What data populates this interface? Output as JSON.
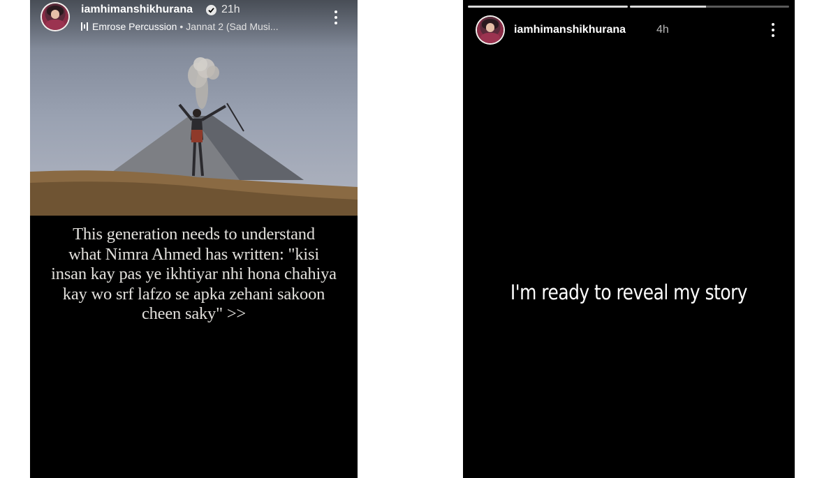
{
  "story_left": {
    "username": "iamhimanshikhurana",
    "time": "21h",
    "verified": true,
    "music": {
      "artist": "Emrose Percussion",
      "separator": "•",
      "song": "Jannat 2 (Sad Musi..."
    },
    "caption_lines": [
      "This generation needs to understand",
      "what Nimra Ahmed has written: \"kisi",
      "insan kay pas ye ikhtiyar nhi hona chahiya",
      "kay wo srf lafzo se apka zehani sakoon",
      "cheen saky\" >>"
    ],
    "icons": {
      "more": "more-vertical-icon",
      "verified": "verified-badge-icon",
      "music": "music-bars-icon"
    }
  },
  "story_right": {
    "username": "iamhimanshikhurana",
    "time": "4h",
    "progress": [
      1.0,
      0.48
    ],
    "text": "I'm ready to reveal my story",
    "icons": {
      "more": "more-vertical-icon"
    }
  },
  "colors": {
    "story_background": "#000000",
    "page_background": "#ffffff",
    "caption_text": "#e2e0dc"
  }
}
